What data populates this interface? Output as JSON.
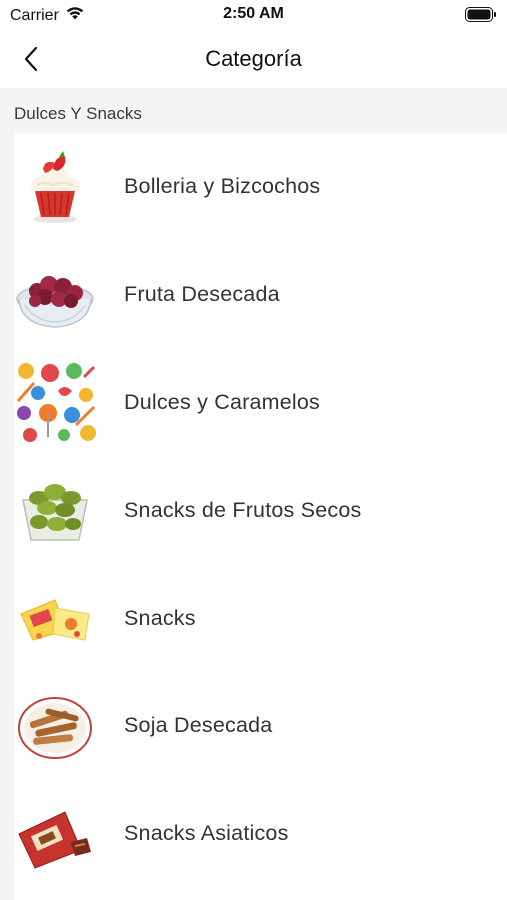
{
  "status_bar": {
    "carrier": "Carrier",
    "time": "2:50 AM",
    "icons": [
      "wifi-icon",
      "battery-icon"
    ]
  },
  "nav": {
    "title": "Categoría",
    "back_icon": "chevron-left-icon"
  },
  "section": {
    "title": "Dulces Y Snacks"
  },
  "categories": [
    {
      "label": "Bolleria y Bizcochos",
      "icon": "cupcake-icon"
    },
    {
      "label": "Fruta Desecada",
      "icon": "dried-fruit-bowl-icon"
    },
    {
      "label": "Dulces y Caramelos",
      "icon": "candy-icon"
    },
    {
      "label": "Snacks de Frutos Secos",
      "icon": "nuts-basket-icon"
    },
    {
      "label": "Snacks",
      "icon": "snack-bags-icon"
    },
    {
      "label": "Soja Desecada",
      "icon": "dried-soy-plate-icon"
    },
    {
      "label": "Snacks Asiaticos",
      "icon": "asian-snack-pack-icon"
    }
  ],
  "colors": {
    "background": "#f4f4f4",
    "surface": "#ffffff",
    "text": "#333333"
  }
}
